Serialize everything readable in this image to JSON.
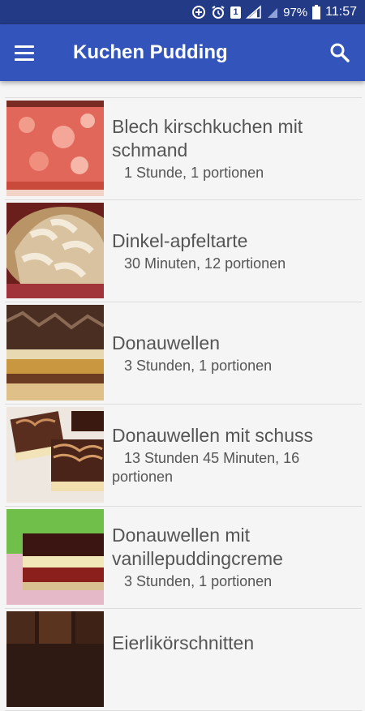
{
  "statusbar": {
    "battery": "97%",
    "time": "11:57",
    "sim_badge": "1"
  },
  "appbar": {
    "title": "Kuchen Pudding",
    "menu_icon": "hamburger-menu-icon",
    "search_icon": "search-icon"
  },
  "recipes": [
    {
      "name": "Blech kirschkuchen mit schmand",
      "meta": "1 Stunde, 1 portionen"
    },
    {
      "name": "Dinkel-apfeltarte",
      "meta": "30 Minuten, 12 portionen"
    },
    {
      "name": "Donauwellen",
      "meta": "3 Stunden, 1 portionen"
    },
    {
      "name": "Donauwellen mit schuss",
      "meta": "13 Stunden 45 Minuten, 16 portionen"
    },
    {
      "name": "Donauwellen mit vanillepuddingcreme",
      "meta": "3 Stunden, 1 portionen"
    },
    {
      "name": "Eierlikörschnitten",
      "meta": ""
    }
  ]
}
